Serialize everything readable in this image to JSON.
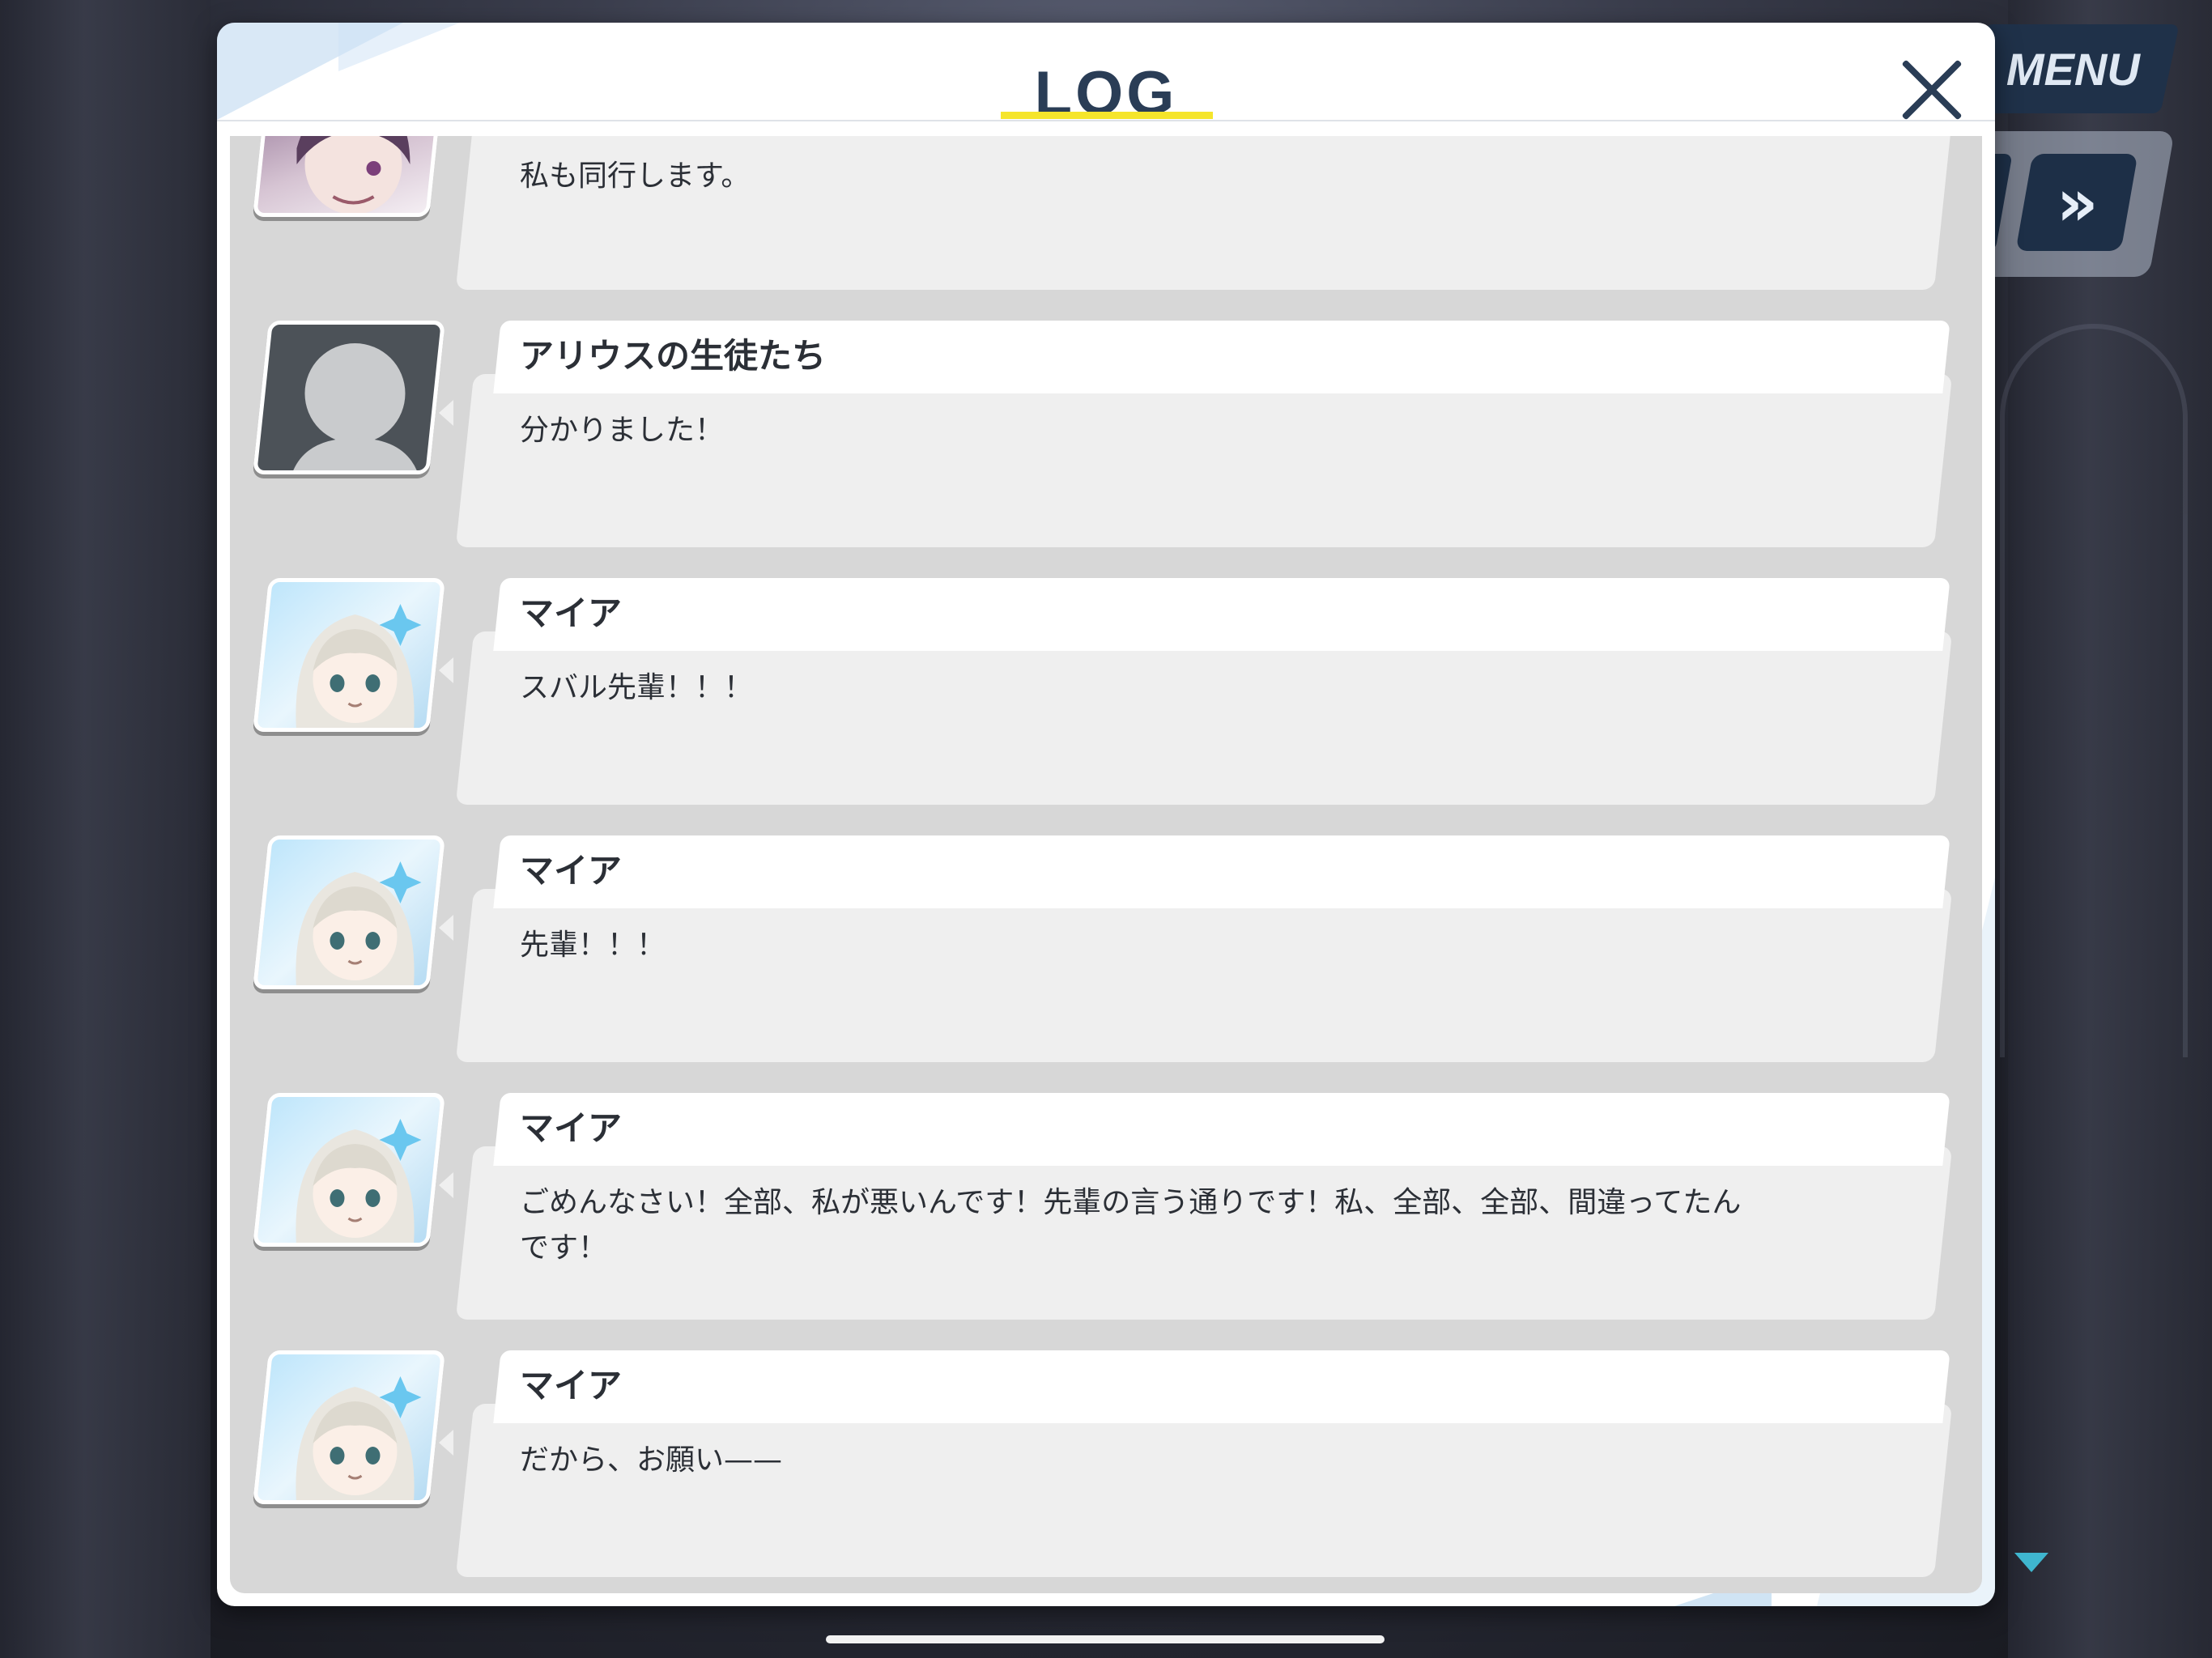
{
  "header": {
    "title": "LOG"
  },
  "top_controls": {
    "menu_label": "MENU",
    "skip_label": "»"
  },
  "entries": [
    {
      "avatar": "purple-hair-character",
      "name": "",
      "text": "私も同行します。"
    },
    {
      "avatar": "anonymous-silhouette",
      "name": "アリウスの生徒たち",
      "text": "分かりました！"
    },
    {
      "avatar": "maia",
      "name": "マイア",
      "text": "スバル先輩！！！"
    },
    {
      "avatar": "maia",
      "name": "マイア",
      "text": "先輩！！！"
    },
    {
      "avatar": "maia",
      "name": "マイア",
      "text": "ごめんなさい！全部、私が悪いんです！先輩の言う通りです！私、全部、全部、間違ってたん\nです！"
    },
    {
      "avatar": "maia",
      "name": "マイア",
      "text": "だから、お願い——"
    }
  ],
  "colors": {
    "accent_underline": "#f5e52b",
    "title": "#2a3d56",
    "scroll_arrow": "#3fb6cf"
  }
}
